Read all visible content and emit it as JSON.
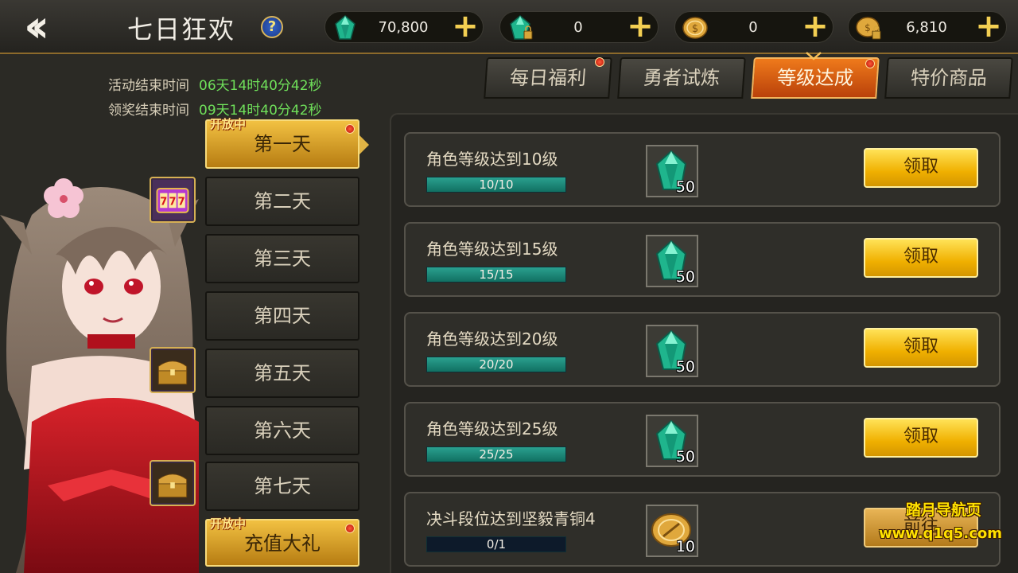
{
  "header": {
    "back_icon": "double-chevron-left",
    "title": "七日狂欢",
    "help_glyph": "?",
    "plus_glyph": "+",
    "currencies": [
      {
        "name": "diamond",
        "value": "70,800"
      },
      {
        "name": "bound-diamond",
        "value": "0"
      },
      {
        "name": "coin",
        "value": "0"
      },
      {
        "name": "bound-coin",
        "value": "6,810"
      }
    ]
  },
  "timers": {
    "activity_end_label": "活动结束时间",
    "activity_end_value": "06天14时40分42秒",
    "reward_end_label": "领奖结束时间",
    "reward_end_value": "09天14时40分42秒"
  },
  "days": {
    "open_badge": "开放中",
    "items": [
      {
        "label": "第一天",
        "active": true
      },
      {
        "label": "第二天",
        "active": false
      },
      {
        "label": "第三天",
        "active": false
      },
      {
        "label": "第四天",
        "active": false
      },
      {
        "label": "第五天",
        "active": false
      },
      {
        "label": "第六天",
        "active": false
      },
      {
        "label": "第七天",
        "active": false
      }
    ],
    "recharge_label": "充值大礼",
    "recharge_badge": "开放中"
  },
  "tabs": [
    {
      "label": "每日福利",
      "active": false,
      "dot": true
    },
    {
      "label": "勇者试炼",
      "active": false,
      "dot": false
    },
    {
      "label": "等级达成",
      "active": true,
      "dot": true
    },
    {
      "label": "特价商品",
      "active": false,
      "dot": false
    }
  ],
  "tasks": [
    {
      "title": "角色等级达到10级",
      "progress": "10/10",
      "ratio": 1.0,
      "reward_icon": "diamond-icon",
      "reward_qty": "50",
      "button": "领取"
    },
    {
      "title": "角色等级达到15级",
      "progress": "15/15",
      "ratio": 1.0,
      "reward_icon": "diamond-icon",
      "reward_qty": "50",
      "button": "领取"
    },
    {
      "title": "角色等级达到20级",
      "progress": "20/20",
      "ratio": 1.0,
      "reward_icon": "diamond-icon",
      "reward_qty": "50",
      "button": "领取"
    },
    {
      "title": "角色等级达到25级",
      "progress": "25/25",
      "ratio": 1.0,
      "reward_icon": "diamond-icon",
      "reward_qty": "50",
      "button": "领取"
    },
    {
      "title": "决斗段位达到坚毅青铜4",
      "progress": "0/1",
      "ratio": 0.0,
      "reward_icon": "coin-icon",
      "reward_qty": "10",
      "button": "前往"
    }
  ],
  "watermark": {
    "line1": "踏月导航页",
    "line2": "www.q1q5.com"
  },
  "colors": {
    "gold": "#f0b000",
    "active_tab": "#d85a10",
    "timer_green": "#6fe05a",
    "progress_fill": "#1f8a7a"
  }
}
